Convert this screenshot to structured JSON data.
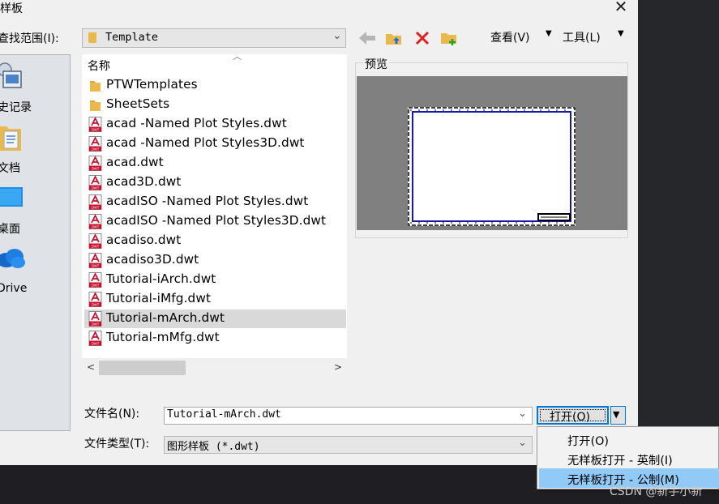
{
  "dialog": {
    "title": "样板",
    "close_symbol": "✕"
  },
  "lookin": {
    "label": "查找范围(I):",
    "value": "Template"
  },
  "toolbar": {
    "view_label": "查看(V)",
    "tools_label": "工具(L)"
  },
  "places": [
    {
      "label": "史记录",
      "icon": "history-icon"
    },
    {
      "label": "文档",
      "icon": "documents-icon"
    },
    {
      "label": "桌面",
      "icon": "desktop-icon"
    },
    {
      "label": "Drive",
      "icon": "onedrive-icon"
    }
  ],
  "filelist": {
    "column_name": "名称",
    "items": [
      {
        "name": "PTWTemplates",
        "type": "folder"
      },
      {
        "name": "SheetSets",
        "type": "folder"
      },
      {
        "name": "acad -Named Plot Styles.dwt",
        "type": "dwt"
      },
      {
        "name": "acad -Named Plot Styles3D.dwt",
        "type": "dwt"
      },
      {
        "name": "acad.dwt",
        "type": "dwt"
      },
      {
        "name": "acad3D.dwt",
        "type": "dwt"
      },
      {
        "name": "acadISO -Named Plot Styles.dwt",
        "type": "dwt"
      },
      {
        "name": "acadISO -Named Plot Styles3D.dwt",
        "type": "dwt"
      },
      {
        "name": "acadiso.dwt",
        "type": "dwt"
      },
      {
        "name": "acadiso3D.dwt",
        "type": "dwt"
      },
      {
        "name": "Tutorial-iArch.dwt",
        "type": "dwt"
      },
      {
        "name": "Tutorial-iMfg.dwt",
        "type": "dwt"
      },
      {
        "name": "Tutorial-mArch.dwt",
        "type": "dwt",
        "selected": true
      },
      {
        "name": "Tutorial-mMfg.dwt",
        "type": "dwt"
      }
    ],
    "dwt_icon_text": "DWT"
  },
  "preview": {
    "label": "预览"
  },
  "filename": {
    "label": "文件名(N):",
    "value": "Tutorial-mArch.dwt"
  },
  "filetype": {
    "label": "文件类型(T):",
    "value": "图形样板 (*.dwt)"
  },
  "open_button": {
    "label": "打开(O)"
  },
  "open_menu": [
    {
      "label": "打开(O)"
    },
    {
      "label": "无样板打开 - 英制(I)"
    },
    {
      "label": "无样板打开 - 公制(M)",
      "highlighted": true
    }
  ],
  "watermark": "CSDN @新手小新",
  "colors": {
    "accent": "#0078d7",
    "menu_highlight": "#91c9f7",
    "selected_row": "#d9d9d9",
    "folder": "#e9b94b",
    "dwt_red": "#c8102e"
  }
}
